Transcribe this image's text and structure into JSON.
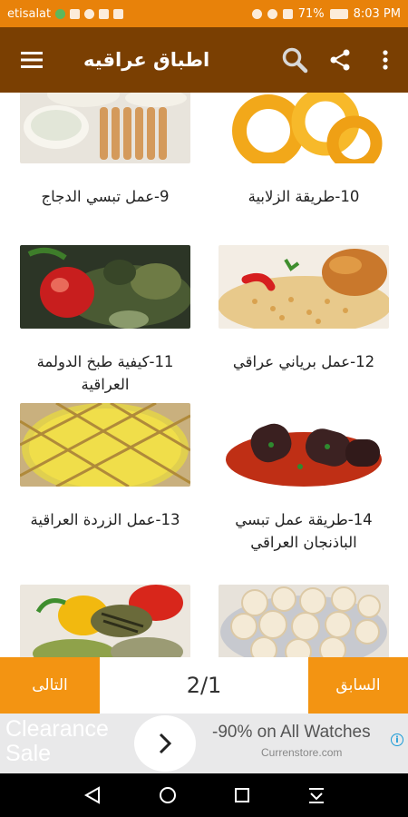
{
  "status": {
    "carrier": "etisalat",
    "battery": "71%",
    "time": "8:03 PM"
  },
  "app_bar": {
    "title": "اطباق عراقيه",
    "menu_icon": "hamburger-icon",
    "search_icon": "search-icon",
    "share_icon": "share-icon",
    "overflow_icon": "more-vert-icon"
  },
  "recipes": [
    {
      "label": "9-عمل تبسي الدجاج",
      "image": "chicken-skewers-yogurt"
    },
    {
      "label": "10-طريقة الزلابية",
      "image": "zalabia-sweets"
    },
    {
      "label": "11-كيفية طبخ الدولمة العراقية",
      "image": "dolma-stuffed-vegetables"
    },
    {
      "label": "12-عمل برياني عراقي",
      "image": "biryani-rice-chicken"
    },
    {
      "label": "13-عمل الزردة العراقية",
      "image": "zarda-rice-pudding"
    },
    {
      "label": "14-طريقة عمل تبسي الباذنجان العراقي",
      "image": "eggplant-tepsi"
    },
    {
      "label": "",
      "image": "grilled-vegetables"
    },
    {
      "label": "",
      "image": "kleicha-cookies"
    }
  ],
  "pager": {
    "prev_label": "السابق",
    "next_label": "التالى",
    "indicator": "2/1"
  },
  "ad": {
    "left_text_line1": "Clearance",
    "left_text_line2": "Sale",
    "headline": "-90% on All Watches",
    "source": "Currenstore.com",
    "arrow_icon": "chevron-right-icon",
    "info_icon": "info-icon"
  },
  "system_nav": {
    "back_icon": "back-icon",
    "home_icon": "home-icon",
    "recents_icon": "recents-icon",
    "notifications_icon": "pull-down-icon"
  },
  "colors": {
    "status_bar": "#e8820a",
    "app_bar": "#7a3f02",
    "button": "#f39412"
  }
}
